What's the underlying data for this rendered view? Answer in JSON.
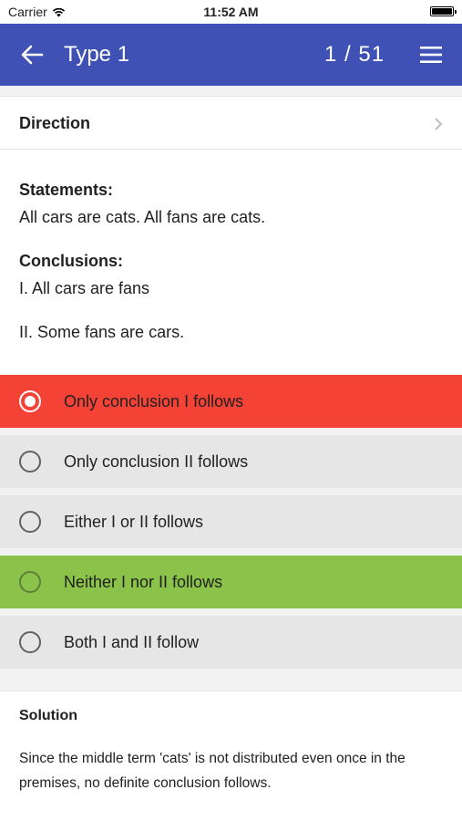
{
  "status_bar": {
    "carrier": "Carrier",
    "time": "11:52 AM"
  },
  "app_bar": {
    "title": "Type 1",
    "counter": "1  / 51",
    "color": "#3f51b5"
  },
  "direction": {
    "label": "Direction"
  },
  "question": {
    "statements_heading": "Statements:",
    "statements_text": "All cars are cats. All fans are cats.",
    "conclusions_heading": "Conclusions:",
    "conclusion_1": "I. All cars are fans",
    "conclusion_2": "II. Some fans are cars."
  },
  "options": [
    {
      "label": "Only conclusion I follows",
      "state": "selected-wrong",
      "color": "#f44336"
    },
    {
      "label": "Only conclusion II follows",
      "state": "default",
      "color": "#e6e6e6"
    },
    {
      "label": "Either I or II follows",
      "state": "default",
      "color": "#e6e6e6"
    },
    {
      "label": "Neither I nor II follows",
      "state": "correct",
      "color": "#8bc34a"
    },
    {
      "label": "Both I and II follow",
      "state": "default",
      "color": "#e6e6e6"
    }
  ],
  "solution": {
    "heading": "Solution",
    "text": "Since the middle term 'cats' is not distributed even once in the premises, no definite conclusion follows."
  }
}
